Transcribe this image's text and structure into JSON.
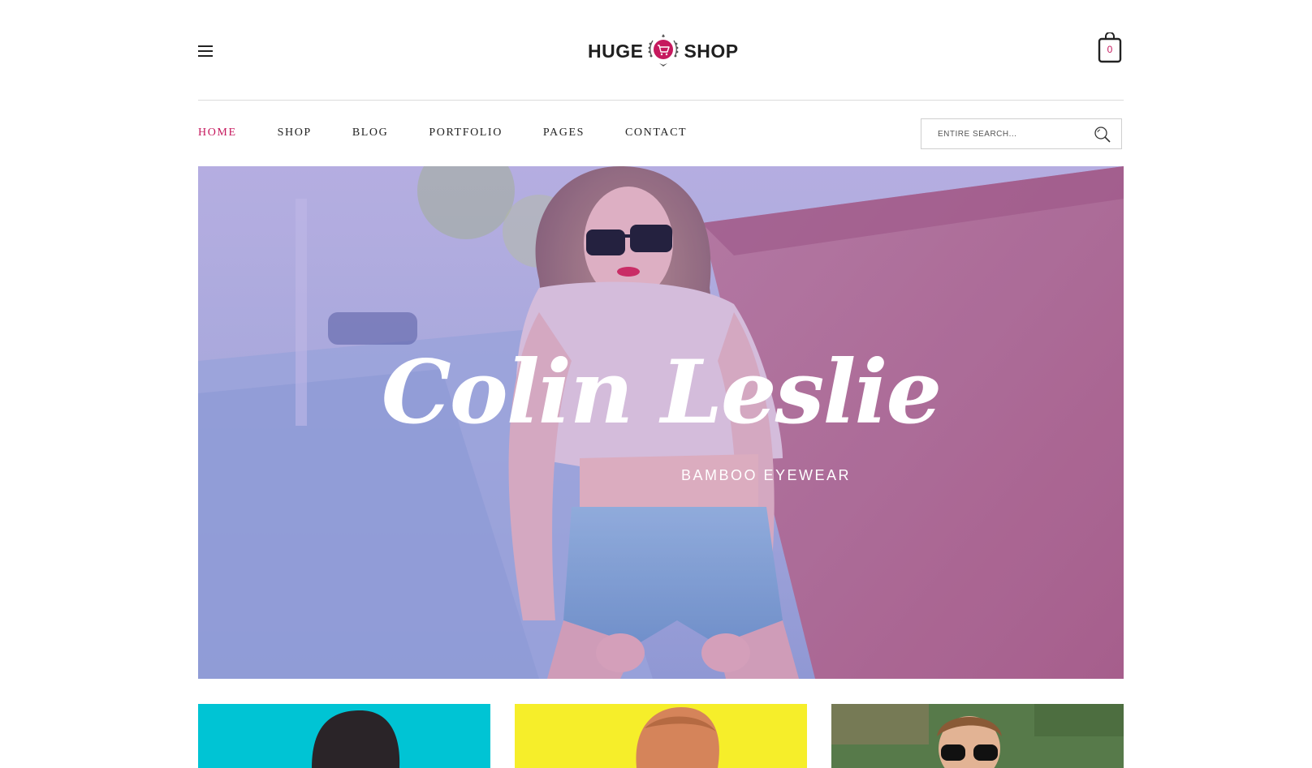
{
  "header": {
    "logo_left": "HUGE",
    "logo_right": "SHOP",
    "cart_count": "0"
  },
  "nav": {
    "items": [
      {
        "label": "HOME",
        "active": true
      },
      {
        "label": "SHOP",
        "active": false
      },
      {
        "label": "BLOG",
        "active": false
      },
      {
        "label": "PORTFOLIO",
        "active": false
      },
      {
        "label": "PAGES",
        "active": false
      },
      {
        "label": "CONTACT",
        "active": false
      }
    ],
    "search_placeholder": "ENTIRE SEARCH..."
  },
  "hero": {
    "script_text": "Colin Leslie",
    "subtitle": "BAMBOO EYEWEAR"
  },
  "colors": {
    "accent": "#c6195e",
    "thumb_1_bg": "#00c4d4",
    "thumb_2_bg": "#f6ee2a",
    "thumb_3_bg": "#6a8a5a"
  }
}
